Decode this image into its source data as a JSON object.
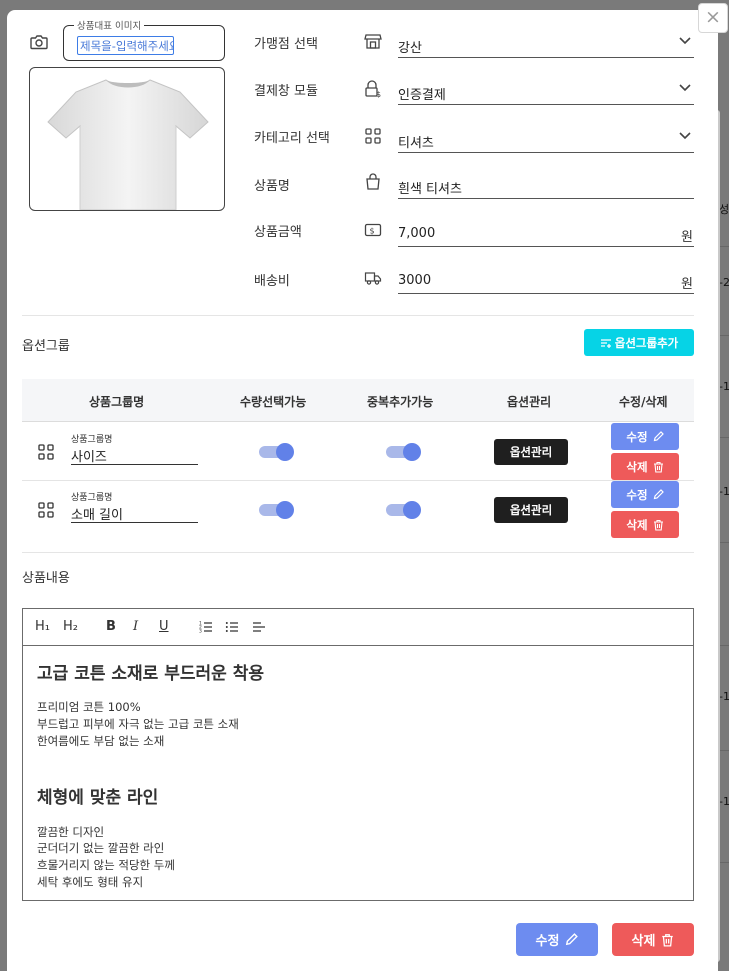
{
  "background": {
    "items": [
      "성",
      "-2",
      "-1",
      "-1",
      "-1",
      "-1"
    ]
  },
  "close_icon": "×",
  "image": {
    "legend": "상품대표 이미지",
    "input_value": "제목을-입력해주세요"
  },
  "form": {
    "store": {
      "label": "가맹점 선택",
      "value": "강산",
      "icon": "store-icon"
    },
    "payment": {
      "label": "결제창 모듈",
      "value": "인증결제",
      "icon": "lock-dollar-icon"
    },
    "category": {
      "label": "카테고리 선택",
      "value": "티셔츠",
      "icon": "grid-icon"
    },
    "name": {
      "label": "상품명",
      "value": "흰색 티셔츠",
      "icon": "shopping-bag-icon"
    },
    "price": {
      "label": "상품금액",
      "value": "7,000",
      "unit": "원",
      "icon": "money-icon"
    },
    "shipping": {
      "label": "배송비",
      "value": "3000",
      "unit": "원",
      "icon": "truck-icon"
    }
  },
  "options": {
    "title": "옵션그룹",
    "add_button": "옵션그룹추가",
    "headers": [
      "상품그룹명",
      "수량선택가능",
      "중복추가가능",
      "옵션관리",
      "수정/삭제"
    ],
    "rows": [
      {
        "field_label": "상품그룹명",
        "name": "사이즈",
        "qty_selectable": true,
        "dup_addable": true,
        "manage": "옵션관리",
        "edit": "수정",
        "delete": "삭제"
      },
      {
        "field_label": "상품그룹명",
        "name": "소매 길이",
        "qty_selectable": true,
        "dup_addable": true,
        "manage": "옵션관리",
        "edit": "수정",
        "delete": "삭제"
      }
    ]
  },
  "content": {
    "title": "상품내용",
    "toolbar": {
      "h1": "H₁",
      "h2": "H₂",
      "bold": "B",
      "italic": "I",
      "underline": "U"
    },
    "heading1": "고급 코튼 소재로 부드러운 착용",
    "para1": [
      "프리미엄 코튼 100%",
      "부드럽고 피부에 자극 없는 고급 코튼 소재",
      "한여름에도 부담 없는 소재"
    ],
    "heading2": "체형에 맞춘 라인",
    "para2": [
      "깔끔한 디자인",
      "군더더기 없는 깔끔한 라인",
      "흐물거리지 않는 적당한 두께",
      "세탁 후에도 형태 유지"
    ]
  },
  "footer": {
    "edit": "수정",
    "delete": "삭제"
  },
  "colors": {
    "accent_cyan": "#06d3e6",
    "edit_blue": "#6d8cf0",
    "delete_red": "#ee5a5a",
    "toggle_on": "#6181e8"
  }
}
